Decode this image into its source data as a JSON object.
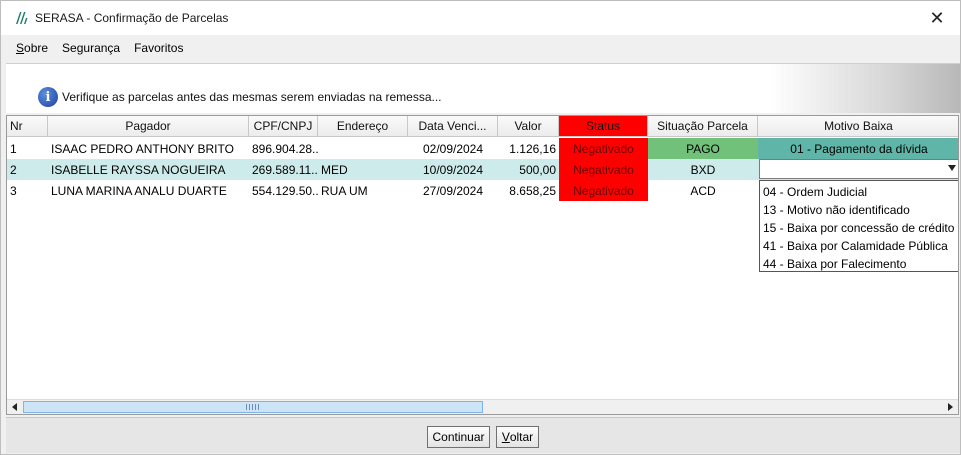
{
  "window": {
    "title": "SERASA - Confirmação de Parcelas",
    "close_symbol": "✕"
  },
  "menu": {
    "items": [
      {
        "label": "Sobre",
        "mnemonic": "S",
        "rest": "obre"
      },
      {
        "label": "Segurança"
      },
      {
        "label": "Favoritos"
      }
    ]
  },
  "info": {
    "icon": "info-icon",
    "icon_glyph": "i",
    "text": "Verifique as parcelas antes das mesmas serem enviadas na remessa..."
  },
  "grid": {
    "columns": [
      "Nr",
      "Pagador",
      "CPF/CNPJ",
      "Endereço",
      "Data Venci...",
      "Valor",
      "Status",
      "Situação Parcela",
      "Motivo Baixa"
    ],
    "rows": [
      {
        "nr": "1",
        "pagador": "ISAAC PEDRO ANTHONY BRITO",
        "cpf": "896.904.28...",
        "endereco": "",
        "data": "02/09/2024",
        "valor": "1.126,16",
        "status": "Negativado",
        "situacao": "PAGO",
        "motivo": "01 - Pagamento da dívida"
      },
      {
        "nr": "2",
        "pagador": "ISABELLE RAYSSA NOGUEIRA",
        "cpf": "269.589.11...",
        "endereco": "MED",
        "data": "10/09/2024",
        "valor": "500,00",
        "status": "Negativado",
        "situacao": "BXD",
        "motivo": ""
      },
      {
        "nr": "3",
        "pagador": "LUNA MARINA ANALU DUARTE",
        "cpf": "554.129.50...",
        "endereco": "RUA UM",
        "data": "27/09/2024",
        "valor": "8.658,25",
        "status": "Negativado",
        "situacao": "ACD",
        "motivo": ""
      }
    ],
    "selected_row": 2,
    "motivo_options": [
      "04 - Ordem Judicial",
      "13 - Motivo não identificado",
      "15 - Baixa por concessão de crédito",
      "41 - Baixa por Calamidade Pública",
      "44 - Baixa por Falecimento"
    ]
  },
  "footer": {
    "continuar_label": "Continuar",
    "voltar_label": "Voltar",
    "voltar_mnemonic": "V",
    "voltar_rest": "oltar"
  },
  "colors": {
    "status_negativado": "#ff0000",
    "situacao_pago": "#72c17a",
    "motivo_paid": "#5fb6a8",
    "selected_row": "#cdebea"
  }
}
